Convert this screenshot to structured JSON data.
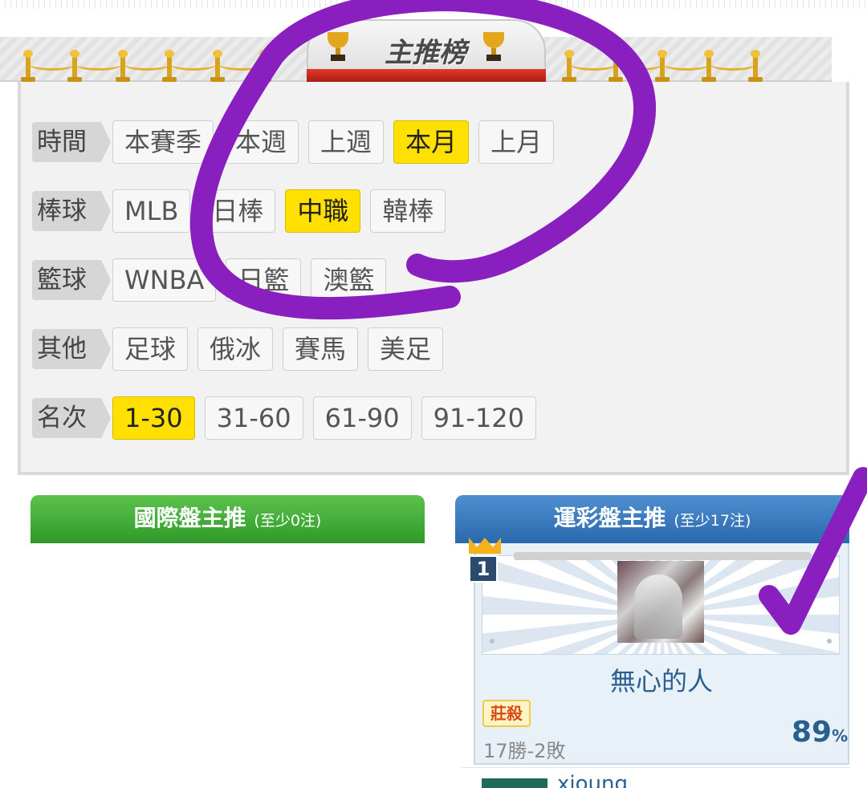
{
  "header": {
    "title": "主推榜"
  },
  "filters": {
    "rows": [
      {
        "label": "時間",
        "options": [
          "本賽季",
          "本週",
          "上週",
          "本月",
          "上月"
        ],
        "active": "本月"
      },
      {
        "label": "棒球",
        "options": [
          "MLB",
          "日棒",
          "中職",
          "韓棒"
        ],
        "active": "中職"
      },
      {
        "label": "籃球",
        "options": [
          "WNBA",
          "日籃",
          "澳籃"
        ],
        "active": ""
      },
      {
        "label": "其他",
        "options": [
          "足球",
          "俄冰",
          "賽馬",
          "美足"
        ],
        "active": ""
      },
      {
        "label": "名次",
        "options": [
          "1-30",
          "31-60",
          "61-90",
          "91-120"
        ],
        "active": "1-30"
      }
    ]
  },
  "columns": {
    "left": {
      "title": "國際盤主推",
      "note": "(至少0注)",
      "color": "#3aa832"
    },
    "right": {
      "title": "運彩盤主推",
      "note": "(至少17注)",
      "color": "#3a7bbf"
    }
  },
  "leaderboard": {
    "rank": "1",
    "name": "無心的人",
    "tag": "莊殺",
    "record": "17勝-2敗",
    "win_rate": "89",
    "win_rate_unit": "%",
    "next_name": "xioung"
  },
  "colors": {
    "active_option": "#ffe000",
    "annotation": "#8a1fc0"
  }
}
